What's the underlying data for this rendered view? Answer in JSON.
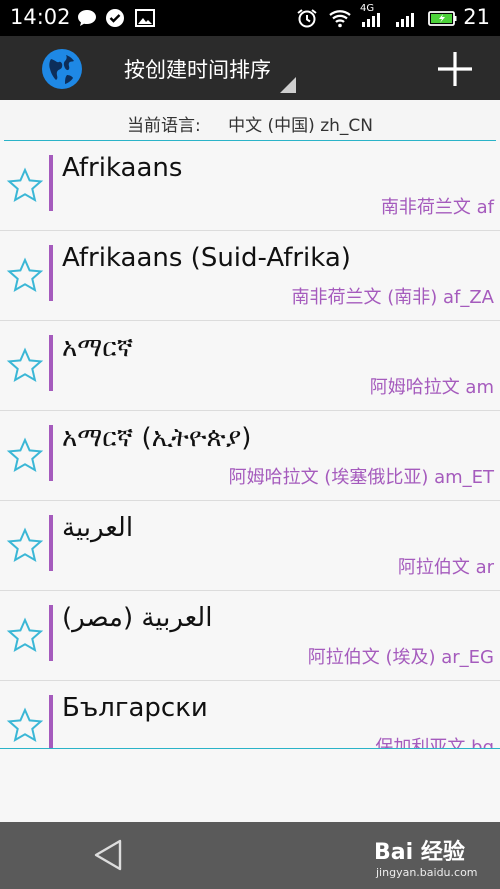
{
  "status_bar": {
    "time": "14:02",
    "battery_level": "21",
    "network_label": "4G"
  },
  "action_bar": {
    "sort_title": "按创建时间排序",
    "add_icon": "plus-icon",
    "app_icon": "globe-icon"
  },
  "current_language": {
    "label": "当前语言:",
    "value": "中文 (中国) zh_CN"
  },
  "languages": [
    {
      "native": "Afrikaans",
      "sub": "南非荷兰文 af"
    },
    {
      "native": "Afrikaans (Suid-Afrika)",
      "sub": "南非荷兰文 (南非) af_ZA"
    },
    {
      "native": "አማርኛ",
      "sub": "阿姆哈拉文 am"
    },
    {
      "native": "አማርኛ (ኢትዮጵያ)",
      "sub": "阿姆哈拉文 (埃塞俄比亚) am_ET"
    },
    {
      "native": "العربية",
      "sub": "阿拉伯文 ar"
    },
    {
      "native": "العربية (مصر)",
      "sub": "阿拉伯文 (埃及) ar_EG"
    },
    {
      "native": "Български",
      "sub": "保加利亚文 bg"
    }
  ],
  "watermark": {
    "text": "Bai 经验",
    "url": "jingyan.baidu.com"
  },
  "colors": {
    "accent_purple": "#a55bbd",
    "accent_cyan": "#2ab3c8",
    "star_stroke": "#3bb7d6"
  }
}
